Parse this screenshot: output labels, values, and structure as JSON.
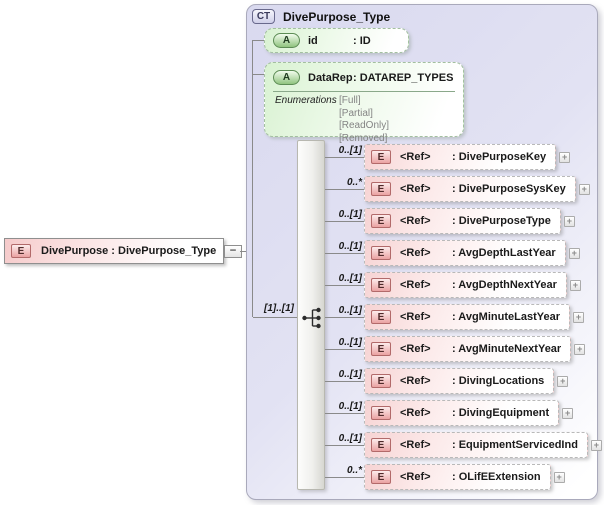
{
  "root_element": {
    "badge": "E",
    "label": "DivePurpose : DivePurpose_Type"
  },
  "complex_type": {
    "badge": "CT",
    "title": "DivePurpose_Type",
    "attributes": [
      {
        "badge": "A",
        "name": "id",
        "type": ": ID"
      },
      {
        "badge": "A",
        "name": "DataRep",
        "type": ": DATAREP_TYPES",
        "enumerations_label": "Enumerations",
        "enumerations": [
          "[Full]",
          "[Partial]",
          "[ReadOnly]",
          "[Removed]"
        ]
      }
    ],
    "sequence": {
      "cardinality": "[1]..[1]",
      "elements": [
        {
          "cardinality": "0..[1]",
          "badge": "E",
          "ref": "<Ref>",
          "type": ": DivePurposeKey"
        },
        {
          "cardinality": "0..*",
          "badge": "E",
          "ref": "<Ref>",
          "type": ": DivePurposeSysKey"
        },
        {
          "cardinality": "0..[1]",
          "badge": "E",
          "ref": "<Ref>",
          "type": ": DivePurposeType"
        },
        {
          "cardinality": "0..[1]",
          "badge": "E",
          "ref": "<Ref>",
          "type": ": AvgDepthLastYear"
        },
        {
          "cardinality": "0..[1]",
          "badge": "E",
          "ref": "<Ref>",
          "type": ": AvgDepthNextYear"
        },
        {
          "cardinality": "0..[1]",
          "badge": "E",
          "ref": "<Ref>",
          "type": ": AvgMinuteLastYear"
        },
        {
          "cardinality": "0..[1]",
          "badge": "E",
          "ref": "<Ref>",
          "type": ": AvgMinuteNextYear"
        },
        {
          "cardinality": "0..[1]",
          "badge": "E",
          "ref": "<Ref>",
          "type": ": DivingLocations"
        },
        {
          "cardinality": "0..[1]",
          "badge": "E",
          "ref": "<Ref>",
          "type": ": DivingEquipment"
        },
        {
          "cardinality": "0..[1]",
          "badge": "E",
          "ref": "<Ref>",
          "type": ": EquipmentServicedInd"
        },
        {
          "cardinality": "0..*",
          "badge": "E",
          "ref": "<Ref>",
          "type": ": OLifEExtension"
        }
      ]
    }
  },
  "icons": {
    "collapse_glyph": "−",
    "expand_glyph": "+",
    "sequence_icon": "sequence-compositor"
  },
  "colors": {
    "container_fill": "#dcdcf0",
    "element_fill": "#f6d3d3",
    "element_badge": "#eaa2a2",
    "attribute_fill": "#d9f2d2",
    "attribute_badge": "#90c47f",
    "ct_badge": "#cfcfe9",
    "connector": "#8a8a8a"
  }
}
